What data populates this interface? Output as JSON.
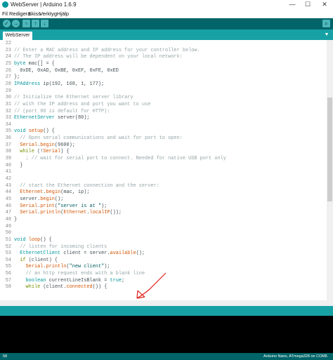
{
  "window": {
    "title": "WebServer | Arduino 1.6.9",
    "controls": [
      "—",
      "☐",
      "✕"
    ]
  },
  "menu": [
    "Fil",
    "Redigera",
    "Skiss",
    "Verktyg",
    "Hjälp"
  ],
  "toolbar": {
    "verify_icon": "check-icon",
    "upload_icon": "arrow-right-icon",
    "new_icon": "new-file-icon",
    "open_icon": "open-icon",
    "save_icon": "save-icon",
    "serial_monitor_icon": "magnifier-icon"
  },
  "tabs": [
    {
      "label": "WebServer"
    }
  ],
  "tab_menu_glyph": "▼",
  "editor": {
    "lines": [
      {
        "n": "22",
        "segments": [
          {
            "t": "",
            "c": ""
          }
        ]
      },
      {
        "n": "23",
        "segments": [
          {
            "t": "// Enter a MAC address and IP address for your controller below.",
            "c": "comment"
          }
        ]
      },
      {
        "n": "24",
        "segments": [
          {
            "t": "// The IP address will be dependent on your local network:",
            "c": "comment"
          }
        ]
      },
      {
        "n": "25",
        "segments": [
          {
            "t": "byte",
            "c": "type"
          },
          {
            "t": " mac[] = {",
            "c": ""
          }
        ]
      },
      {
        "n": "26",
        "segments": [
          {
            "t": "  0xDE, 0xAD, 0xBE, 0xEF, 0xFE, 0xED",
            "c": ""
          }
        ]
      },
      {
        "n": "27",
        "segments": [
          {
            "t": "};",
            "c": ""
          }
        ]
      },
      {
        "n": "28",
        "segments": [
          {
            "t": "IPAddress",
            "c": "type"
          },
          {
            "t": " ip(192, 168, 1, 177);",
            "c": ""
          }
        ]
      },
      {
        "n": "29",
        "segments": [
          {
            "t": "",
            "c": ""
          }
        ]
      },
      {
        "n": "30",
        "segments": [
          {
            "t": "// Initialize the Ethernet server library",
            "c": "comment"
          }
        ]
      },
      {
        "n": "31",
        "segments": [
          {
            "t": "// with the IP address and port you want to use",
            "c": "comment"
          }
        ]
      },
      {
        "n": "32",
        "segments": [
          {
            "t": "// (port 80 is default for HTTP):",
            "c": "comment"
          }
        ]
      },
      {
        "n": "33",
        "segments": [
          {
            "t": "EthernetServer",
            "c": "type"
          },
          {
            "t": " server(80);",
            "c": ""
          }
        ]
      },
      {
        "n": "34",
        "segments": [
          {
            "t": "",
            "c": ""
          }
        ]
      },
      {
        "n": "35",
        "segments": [
          {
            "t": "void",
            "c": "type"
          },
          {
            "t": " ",
            "c": ""
          },
          {
            "t": "setup",
            "c": "func"
          },
          {
            "t": "() {",
            "c": ""
          }
        ]
      },
      {
        "n": "36",
        "segments": [
          {
            "t": "  // Open serial communications and wait for port to open:",
            "c": "comment"
          }
        ]
      },
      {
        "n": "37",
        "segments": [
          {
            "t": "  ",
            "c": ""
          },
          {
            "t": "Serial",
            "c": "func"
          },
          {
            "t": ".",
            "c": ""
          },
          {
            "t": "begin",
            "c": "func"
          },
          {
            "t": "(9600);",
            "c": ""
          }
        ]
      },
      {
        "n": "38",
        "segments": [
          {
            "t": "  ",
            "c": ""
          },
          {
            "t": "while",
            "c": "kw"
          },
          {
            "t": " (!",
            "c": ""
          },
          {
            "t": "Serial",
            "c": "func"
          },
          {
            "t": ") {",
            "c": ""
          }
        ]
      },
      {
        "n": "39",
        "segments": [
          {
            "t": "    ; // wait for serial port to connect. Needed for native USB port only",
            "c": "comment"
          }
        ]
      },
      {
        "n": "40",
        "segments": [
          {
            "t": "  }",
            "c": ""
          }
        ]
      },
      {
        "n": "41",
        "segments": [
          {
            "t": "",
            "c": ""
          }
        ]
      },
      {
        "n": "42",
        "segments": [
          {
            "t": "",
            "c": ""
          }
        ]
      },
      {
        "n": "43",
        "segments": [
          {
            "t": "  // start the Ethernet connection and the server:",
            "c": "comment"
          }
        ]
      },
      {
        "n": "44",
        "segments": [
          {
            "t": "  ",
            "c": ""
          },
          {
            "t": "Ethernet",
            "c": "func"
          },
          {
            "t": ".",
            "c": ""
          },
          {
            "t": "begin",
            "c": "func"
          },
          {
            "t": "(mac, ip);",
            "c": ""
          }
        ]
      },
      {
        "n": "45",
        "segments": [
          {
            "t": "  ",
            "c": ""
          },
          {
            "t": "server",
            "c": ""
          },
          {
            "t": ".",
            "c": ""
          },
          {
            "t": "begin",
            "c": "func"
          },
          {
            "t": "();",
            "c": ""
          }
        ]
      },
      {
        "n": "46",
        "segments": [
          {
            "t": "  ",
            "c": ""
          },
          {
            "t": "Serial",
            "c": "func"
          },
          {
            "t": ".",
            "c": ""
          },
          {
            "t": "print",
            "c": "func"
          },
          {
            "t": "(",
            "c": ""
          },
          {
            "t": "\"server is at \"",
            "c": "str"
          },
          {
            "t": ");",
            "c": ""
          }
        ]
      },
      {
        "n": "47",
        "segments": [
          {
            "t": "  ",
            "c": ""
          },
          {
            "t": "Serial",
            "c": "func"
          },
          {
            "t": ".",
            "c": ""
          },
          {
            "t": "println",
            "c": "func"
          },
          {
            "t": "(",
            "c": ""
          },
          {
            "t": "Ethernet",
            "c": "func"
          },
          {
            "t": ".",
            "c": ""
          },
          {
            "t": "localIP",
            "c": "func"
          },
          {
            "t": "());",
            "c": ""
          }
        ]
      },
      {
        "n": "48",
        "segments": [
          {
            "t": "}",
            "c": ""
          }
        ]
      },
      {
        "n": "49",
        "segments": [
          {
            "t": "",
            "c": ""
          }
        ]
      },
      {
        "n": "50",
        "segments": [
          {
            "t": "",
            "c": ""
          }
        ]
      },
      {
        "n": "51",
        "segments": [
          {
            "t": "void",
            "c": "type"
          },
          {
            "t": " ",
            "c": ""
          },
          {
            "t": "loop",
            "c": "func"
          },
          {
            "t": "() {",
            "c": ""
          }
        ]
      },
      {
        "n": "52",
        "segments": [
          {
            "t": "  // listen for incoming clients",
            "c": "comment"
          }
        ]
      },
      {
        "n": "53",
        "segments": [
          {
            "t": "  ",
            "c": ""
          },
          {
            "t": "EthernetClient",
            "c": "type"
          },
          {
            "t": " client = server.",
            "c": ""
          },
          {
            "t": "available",
            "c": "func"
          },
          {
            "t": "();",
            "c": ""
          }
        ]
      },
      {
        "n": "54",
        "segments": [
          {
            "t": "  ",
            "c": ""
          },
          {
            "t": "if",
            "c": "kw"
          },
          {
            "t": " (client) {",
            "c": ""
          }
        ]
      },
      {
        "n": "55",
        "segments": [
          {
            "t": "    ",
            "c": ""
          },
          {
            "t": "Serial",
            "c": "func"
          },
          {
            "t": ".",
            "c": ""
          },
          {
            "t": "println",
            "c": "func"
          },
          {
            "t": "(",
            "c": ""
          },
          {
            "t": "\"new client\"",
            "c": "str"
          },
          {
            "t": ");",
            "c": ""
          }
        ]
      },
      {
        "n": "56",
        "segments": [
          {
            "t": "    // an http request ends with a blank line",
            "c": "comment"
          }
        ]
      },
      {
        "n": "57",
        "segments": [
          {
            "t": "    ",
            "c": ""
          },
          {
            "t": "boolean",
            "c": "type"
          },
          {
            "t": " currentLineIsBlank = ",
            "c": ""
          },
          {
            "t": "true",
            "c": "type"
          },
          {
            "t": ";",
            "c": ""
          }
        ]
      },
      {
        "n": "58",
        "segments": [
          {
            "t": "    ",
            "c": ""
          },
          {
            "t": "while",
            "c": "kw"
          },
          {
            "t": " (client.",
            "c": ""
          },
          {
            "t": "connected",
            "c": "func"
          },
          {
            "t": "()) {",
            "c": ""
          }
        ]
      }
    ]
  },
  "status": {
    "line_number": "58",
    "board": "Arduino Nano, ATmega328 on COM5"
  },
  "colors": {
    "toolbar_bg": "#006468",
    "tab_bar_bg": "#17a1a5",
    "type": "#00979c",
    "func": "#d35400",
    "comment": "#95a5a6",
    "annotation_stroke": "#e0201a"
  }
}
